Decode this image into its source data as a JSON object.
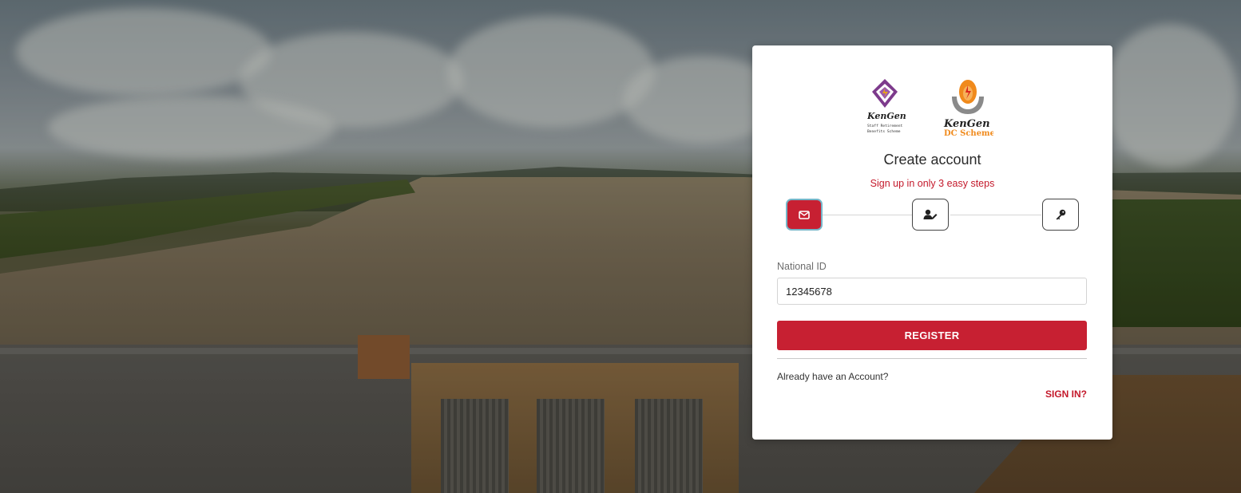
{
  "header": {
    "logo1_word": "KenGen",
    "logo1_sub1": "Staff Retirement",
    "logo1_sub2": "Benefits Scheme",
    "logo2_word": "KenGen",
    "logo2_sub": "DC Scheme"
  },
  "form": {
    "title": "Create account",
    "subtitle": "Sign up in only 3 easy steps",
    "steps": [
      {
        "icon": "envelope-icon",
        "state": "active"
      },
      {
        "icon": "user-edit-icon",
        "state": "idle"
      },
      {
        "icon": "key-icon",
        "state": "idle"
      }
    ],
    "national_id_label": "National ID",
    "national_id_value": "12345678",
    "register_label": "REGISTER",
    "already_text": "Already have an Account?",
    "signin_label": "SIGN IN?"
  },
  "colors": {
    "accent": "#c72032",
    "accent_text": "#c4192b",
    "logo_orange": "#f08a1c",
    "logo_purple": "#7d3a8c"
  }
}
